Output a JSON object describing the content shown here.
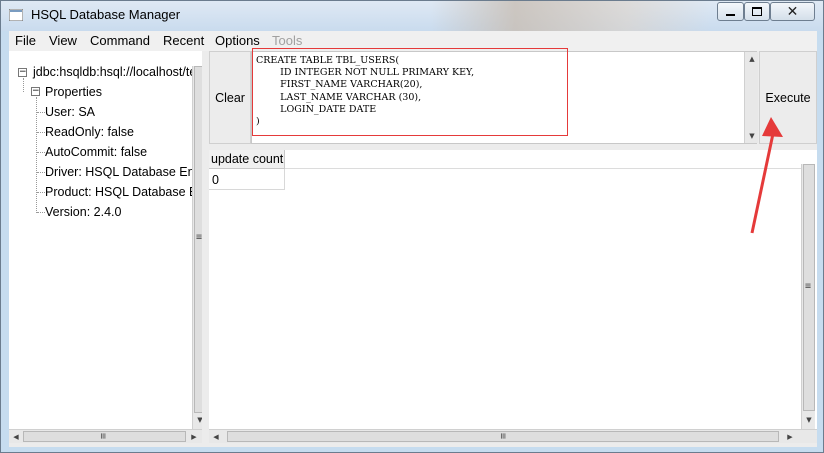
{
  "window": {
    "title": "HSQL Database Manager"
  },
  "menu": [
    {
      "label": "File",
      "enabled": true
    },
    {
      "label": "View",
      "enabled": true
    },
    {
      "label": "Command",
      "enabled": true
    },
    {
      "label": "Recent",
      "enabled": true
    },
    {
      "label": "Options",
      "enabled": true
    },
    {
      "label": "Tools",
      "enabled": false
    }
  ],
  "tree": {
    "root": "jdbc:hsqldb:hsql://localhost/te",
    "properties_label": "Properties",
    "items": [
      "User: SA",
      "ReadOnly: false",
      "AutoCommit: false",
      "Driver: HSQL Database En",
      "Product: HSQL Database E",
      "Version: 2.4.0"
    ]
  },
  "toolbar": {
    "clear_label": "Clear",
    "execute_label": "Execute"
  },
  "editor": {
    "sql_lines": [
      "CREATE TABLE TBL_USERS(",
      "        ID INTEGER NOT NULL PRIMARY KEY,",
      "        FIRST_NAME VARCHAR(20),",
      "        LAST_NAME VARCHAR (30),",
      "        LOGIN_DATE DATE",
      ")"
    ]
  },
  "results": {
    "columns": [
      "update count"
    ],
    "rows": [
      [
        "0"
      ]
    ]
  },
  "annotation": {
    "color": "#e53a3a"
  }
}
